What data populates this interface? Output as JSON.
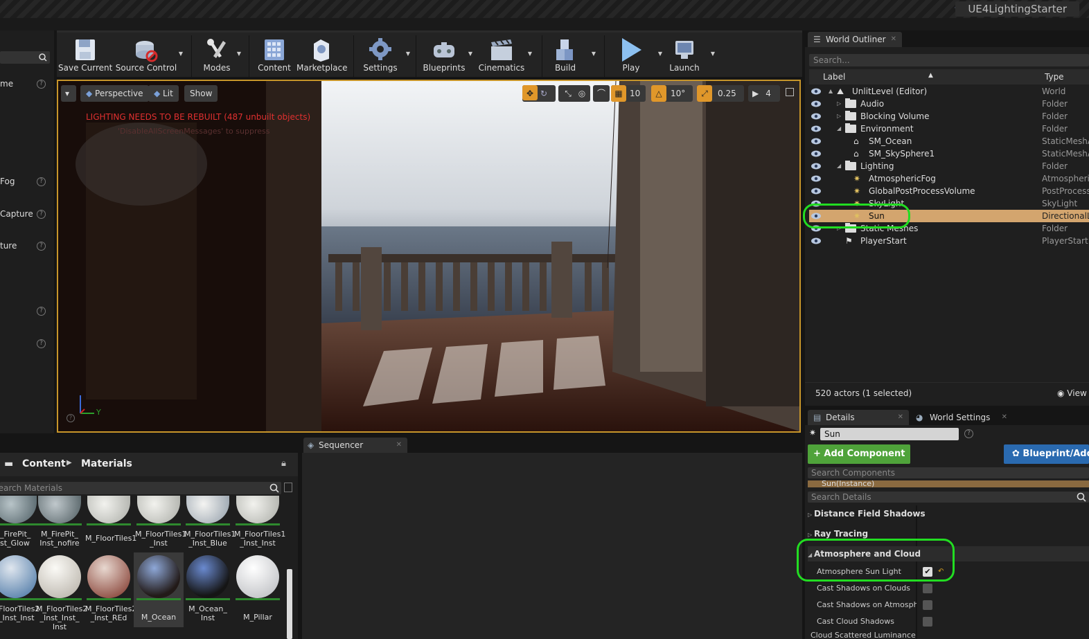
{
  "window": {
    "project_name": "UE4LightingStarter"
  },
  "left_panel": {
    "items": [
      {
        "label": "me"
      },
      {
        "label": "Fog"
      },
      {
        "label": "Capture"
      },
      {
        "label": "ture"
      }
    ]
  },
  "toolbar": {
    "buttons": [
      {
        "label": "Save Current",
        "icon": "save-icon"
      },
      {
        "label": "Source Control",
        "icon": "source-control-icon"
      },
      {
        "label": "Modes",
        "icon": "modes-icon"
      },
      {
        "label": "Content",
        "icon": "content-icon"
      },
      {
        "label": "Marketplace",
        "icon": "marketplace-icon"
      },
      {
        "label": "Settings",
        "icon": "settings-icon"
      },
      {
        "label": "Blueprints",
        "icon": "blueprints-icon"
      },
      {
        "label": "Cinematics",
        "icon": "cinematics-icon"
      },
      {
        "label": "Build",
        "icon": "build-icon"
      },
      {
        "label": "Play",
        "icon": "play-icon"
      },
      {
        "label": "Launch",
        "icon": "launch-icon"
      }
    ]
  },
  "viewport": {
    "view_mode": "Perspective",
    "lighting_mode": "Lit",
    "show_label": "Show",
    "grid_snap": "10",
    "rotation_snap": "10°",
    "scale_snap": "0.25",
    "camera_speed": "4",
    "warning": "LIGHTING NEEDS TO BE REBUILT (487 unbuilt objects)",
    "warning_sub": "'DisableAllScreenMessages' to suppress",
    "axis_y": "Y"
  },
  "content_browser": {
    "path": [
      "Content",
      "Materials"
    ],
    "search_placeholder": "Search Materials",
    "assets_row1": [
      {
        "name": "_FirePit_\nst_Glow"
      },
      {
        "name": "M_FirePit_\nInst_nofire"
      },
      {
        "name": "M_FloorTiles1"
      },
      {
        "name": "M_FloorTiles1\n_Inst"
      },
      {
        "name": "M_FloorTiles1\n_Inst_Blue"
      },
      {
        "name": "M_FloorTiles1\n_Inst_Inst"
      }
    ],
    "assets_row2": [
      {
        "name": "FloorTiles2\n_Inst_Inst"
      },
      {
        "name": "M_FloorTiles2\n_Inst_Inst_\nInst"
      },
      {
        "name": "M_FloorTiles2\n_Inst_REd"
      },
      {
        "name": "M_Ocean"
      },
      {
        "name": "M_Ocean_\nInst"
      },
      {
        "name": "M_Pillar"
      }
    ]
  },
  "sequencer": {
    "tab_label": "Sequencer"
  },
  "world_outliner": {
    "tab_label": "World Outliner",
    "search_placeholder": "Search...",
    "col_label": "Label",
    "col_type": "Type",
    "rows": [
      {
        "name": "UnlitLevel (Editor)",
        "type": "World",
        "indent": 0,
        "kind": "world",
        "arrow": "▲"
      },
      {
        "name": "Audio",
        "type": "Folder",
        "indent": 1,
        "kind": "folder",
        "arrow": "▷"
      },
      {
        "name": "Blocking Volume",
        "type": "Folder",
        "indent": 1,
        "kind": "folder",
        "arrow": "▷"
      },
      {
        "name": "Environment",
        "type": "Folder",
        "indent": 1,
        "kind": "folder",
        "arrow": "◢"
      },
      {
        "name": "SM_Ocean",
        "type": "StaticMeshActor",
        "indent": 2,
        "kind": "mesh",
        "arrow": ""
      },
      {
        "name": "SM_SkySphere1",
        "type": "StaticMeshActor",
        "indent": 2,
        "kind": "mesh",
        "arrow": ""
      },
      {
        "name": "Lighting",
        "type": "Folder",
        "indent": 1,
        "kind": "folder",
        "arrow": "◢"
      },
      {
        "name": "AtmosphericFog",
        "type": "AtmosphericFog",
        "indent": 2,
        "kind": "light",
        "arrow": ""
      },
      {
        "name": "GlobalPostProcessVolume",
        "type": "PostProcessVolume",
        "indent": 2,
        "kind": "light",
        "arrow": ""
      },
      {
        "name": "SkyLight",
        "type": "SkyLight",
        "indent": 2,
        "kind": "light",
        "arrow": ""
      },
      {
        "name": "Sun",
        "type": "DirectionalLight",
        "indent": 2,
        "kind": "light",
        "arrow": "",
        "selected": true
      },
      {
        "name": "Static Meshes",
        "type": "Folder",
        "indent": 1,
        "kind": "folder",
        "arrow": "▷"
      },
      {
        "name": "PlayerStart",
        "type": "PlayerStart",
        "indent": 1,
        "kind": "player",
        "arrow": ""
      }
    ],
    "status": "520 actors (1 selected)",
    "view_options": "View Options"
  },
  "details": {
    "tab_details": "Details",
    "tab_world_settings": "World Settings",
    "object_name": "Sun",
    "add_component": "+ Add Component",
    "blueprint_button": "Blueprint/Add Script",
    "search_components_placeholder": "Search Components",
    "instance_label": "Sun(Instance)",
    "search_details_placeholder": "Search Details",
    "categories": [
      {
        "label": "Distance Field Shadows"
      },
      {
        "label": "Ray Tracing"
      },
      {
        "label": "Atmosphere and Cloud"
      }
    ],
    "properties": [
      {
        "label": "Atmosphere Sun Light",
        "checked": true
      },
      {
        "label": "Cast Shadows on Clouds",
        "checked": false
      },
      {
        "label": "Cast Shadows on Atmosphere",
        "checked": false
      },
      {
        "label": "Cast Cloud Shadows",
        "checked": false
      }
    ],
    "next_property": "Cloud Scattered Luminance Scale"
  },
  "colors": {
    "accent_gold": "#c8962a",
    "selection_row": "#d3a56e",
    "highlight_green": "#22dd22",
    "add_component_green": "#4fa33a",
    "blueprint_blue": "#2a6ab0",
    "warning_red": "#e03030"
  }
}
